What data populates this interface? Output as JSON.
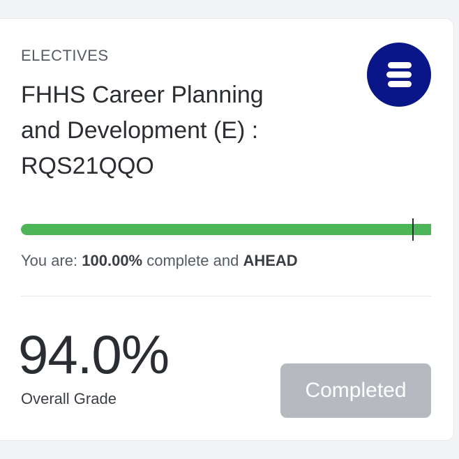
{
  "course": {
    "category": "ELECTIVES",
    "title_line1": "FHHS Career Planning",
    "title_line2": "and Development (E) :",
    "title_line3": "RQS21QQO"
  },
  "logo": {
    "icon": "stacked-bars-logo-icon",
    "color": "#0a1687"
  },
  "progress": {
    "percent_complete": 100,
    "status_prefix": "You are: ",
    "percent_text": "100.00%",
    "status_middle": " complete and ",
    "pace": "AHEAD",
    "bar_color": "#4cb558"
  },
  "grade": {
    "value": "94.0%",
    "label": "Overall Grade"
  },
  "action": {
    "label": "Completed",
    "disabled": true
  }
}
